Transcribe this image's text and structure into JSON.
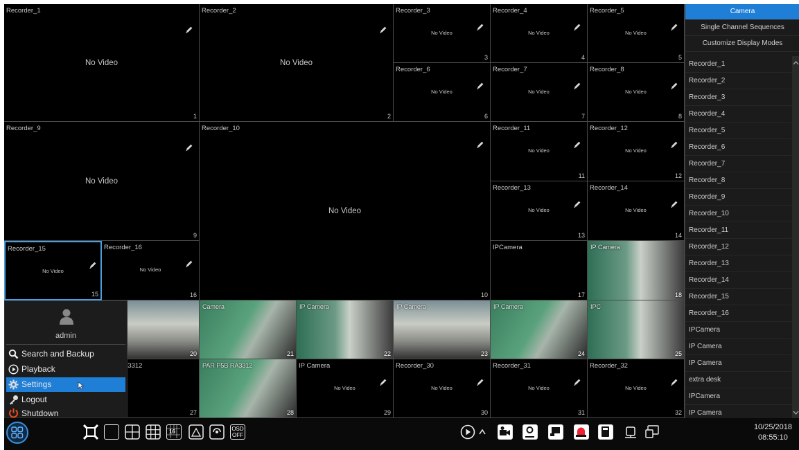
{
  "channels": [
    {
      "name": "Recorder_1",
      "num": "1",
      "status": "No Video"
    },
    {
      "name": "Recorder_2",
      "num": "2",
      "status": "No Video"
    },
    {
      "name": "Recorder_3",
      "num": "3",
      "status": "No Video"
    },
    {
      "name": "Recorder_4",
      "num": "4",
      "status": "No Video"
    },
    {
      "name": "Recorder_5",
      "num": "5",
      "status": "No Video"
    },
    {
      "name": "Recorder_6",
      "num": "6",
      "status": "No Video"
    },
    {
      "name": "Recorder_7",
      "num": "7",
      "status": "No Video"
    },
    {
      "name": "Recorder_8",
      "num": "8",
      "status": "No Video"
    },
    {
      "name": "Recorder_9",
      "num": "9",
      "status": "No Video"
    },
    {
      "name": "Recorder_10",
      "num": "10",
      "status": "No Video"
    },
    {
      "name": "Recorder_11",
      "num": "11",
      "status": "No Video"
    },
    {
      "name": "Recorder_12",
      "num": "12",
      "status": "No Video"
    },
    {
      "name": "Recorder_13",
      "num": "13",
      "status": "No Video"
    },
    {
      "name": "Recorder_14",
      "num": "14",
      "status": "No Video"
    },
    {
      "name": "Recorder_15",
      "num": "15",
      "status": "No Video"
    },
    {
      "name": "Recorder_16",
      "num": "16",
      "status": "No Video"
    },
    {
      "name": "IPCamera",
      "num": "17",
      "status": ""
    },
    {
      "name": "IP Camera",
      "num": "18",
      "status": ""
    },
    {
      "name": "",
      "num": "20",
      "status": ""
    },
    {
      "name": "Camera",
      "num": "21",
      "status": ""
    },
    {
      "name": "IP Camera",
      "num": "22",
      "status": ""
    },
    {
      "name": "IP Camera",
      "num": "23",
      "status": ""
    },
    {
      "name": "IP Camera",
      "num": "24",
      "status": ""
    },
    {
      "name": "IPC",
      "num": "25",
      "status": ""
    },
    {
      "name": "STXIRA3312",
      "num": "27",
      "status": ""
    },
    {
      "name": "PAR P5B RA3312",
      "num": "28",
      "status": ""
    },
    {
      "name": "IP Camera",
      "num": "29",
      "status": "No Video"
    },
    {
      "name": "Recorder_30",
      "num": "30",
      "status": "No Video"
    },
    {
      "name": "Recorder_31",
      "num": "31",
      "status": "No Video"
    },
    {
      "name": "Recorder_32",
      "num": "32",
      "status": "No Video"
    }
  ],
  "sidebar": {
    "tabs": [
      "Camera",
      "Single Channel Sequences",
      "Customize Display Modes"
    ],
    "items": [
      "Recorder_1",
      "Recorder_2",
      "Recorder_3",
      "Recorder_4",
      "Recorder_5",
      "Recorder_6",
      "Recorder_7",
      "Recorder_8",
      "Recorder_9",
      "Recorder_10",
      "Recorder_11",
      "Recorder_12",
      "Recorder_13",
      "Recorder_14",
      "Recorder_15",
      "Recorder_16",
      "IPCamera",
      "IP Camera",
      "IP Camera",
      "extra desk",
      "IPCamera",
      "IP Camera",
      "IP Camera"
    ]
  },
  "menu": {
    "user": "admin",
    "items": [
      "Search and Backup",
      "Playback",
      "Settings",
      "Logout",
      "Shutdown"
    ]
  },
  "toolbar": {
    "osd_line1": "OSD",
    "osd_line2": "OFF",
    "multi_view_label": "16"
  },
  "clock": {
    "date": "10/25/2018",
    "time": "08:55:10"
  },
  "colors": {
    "accent": "#1f7ed6",
    "selected_border": "#4a9fe0",
    "background": "#0d0d0d"
  }
}
